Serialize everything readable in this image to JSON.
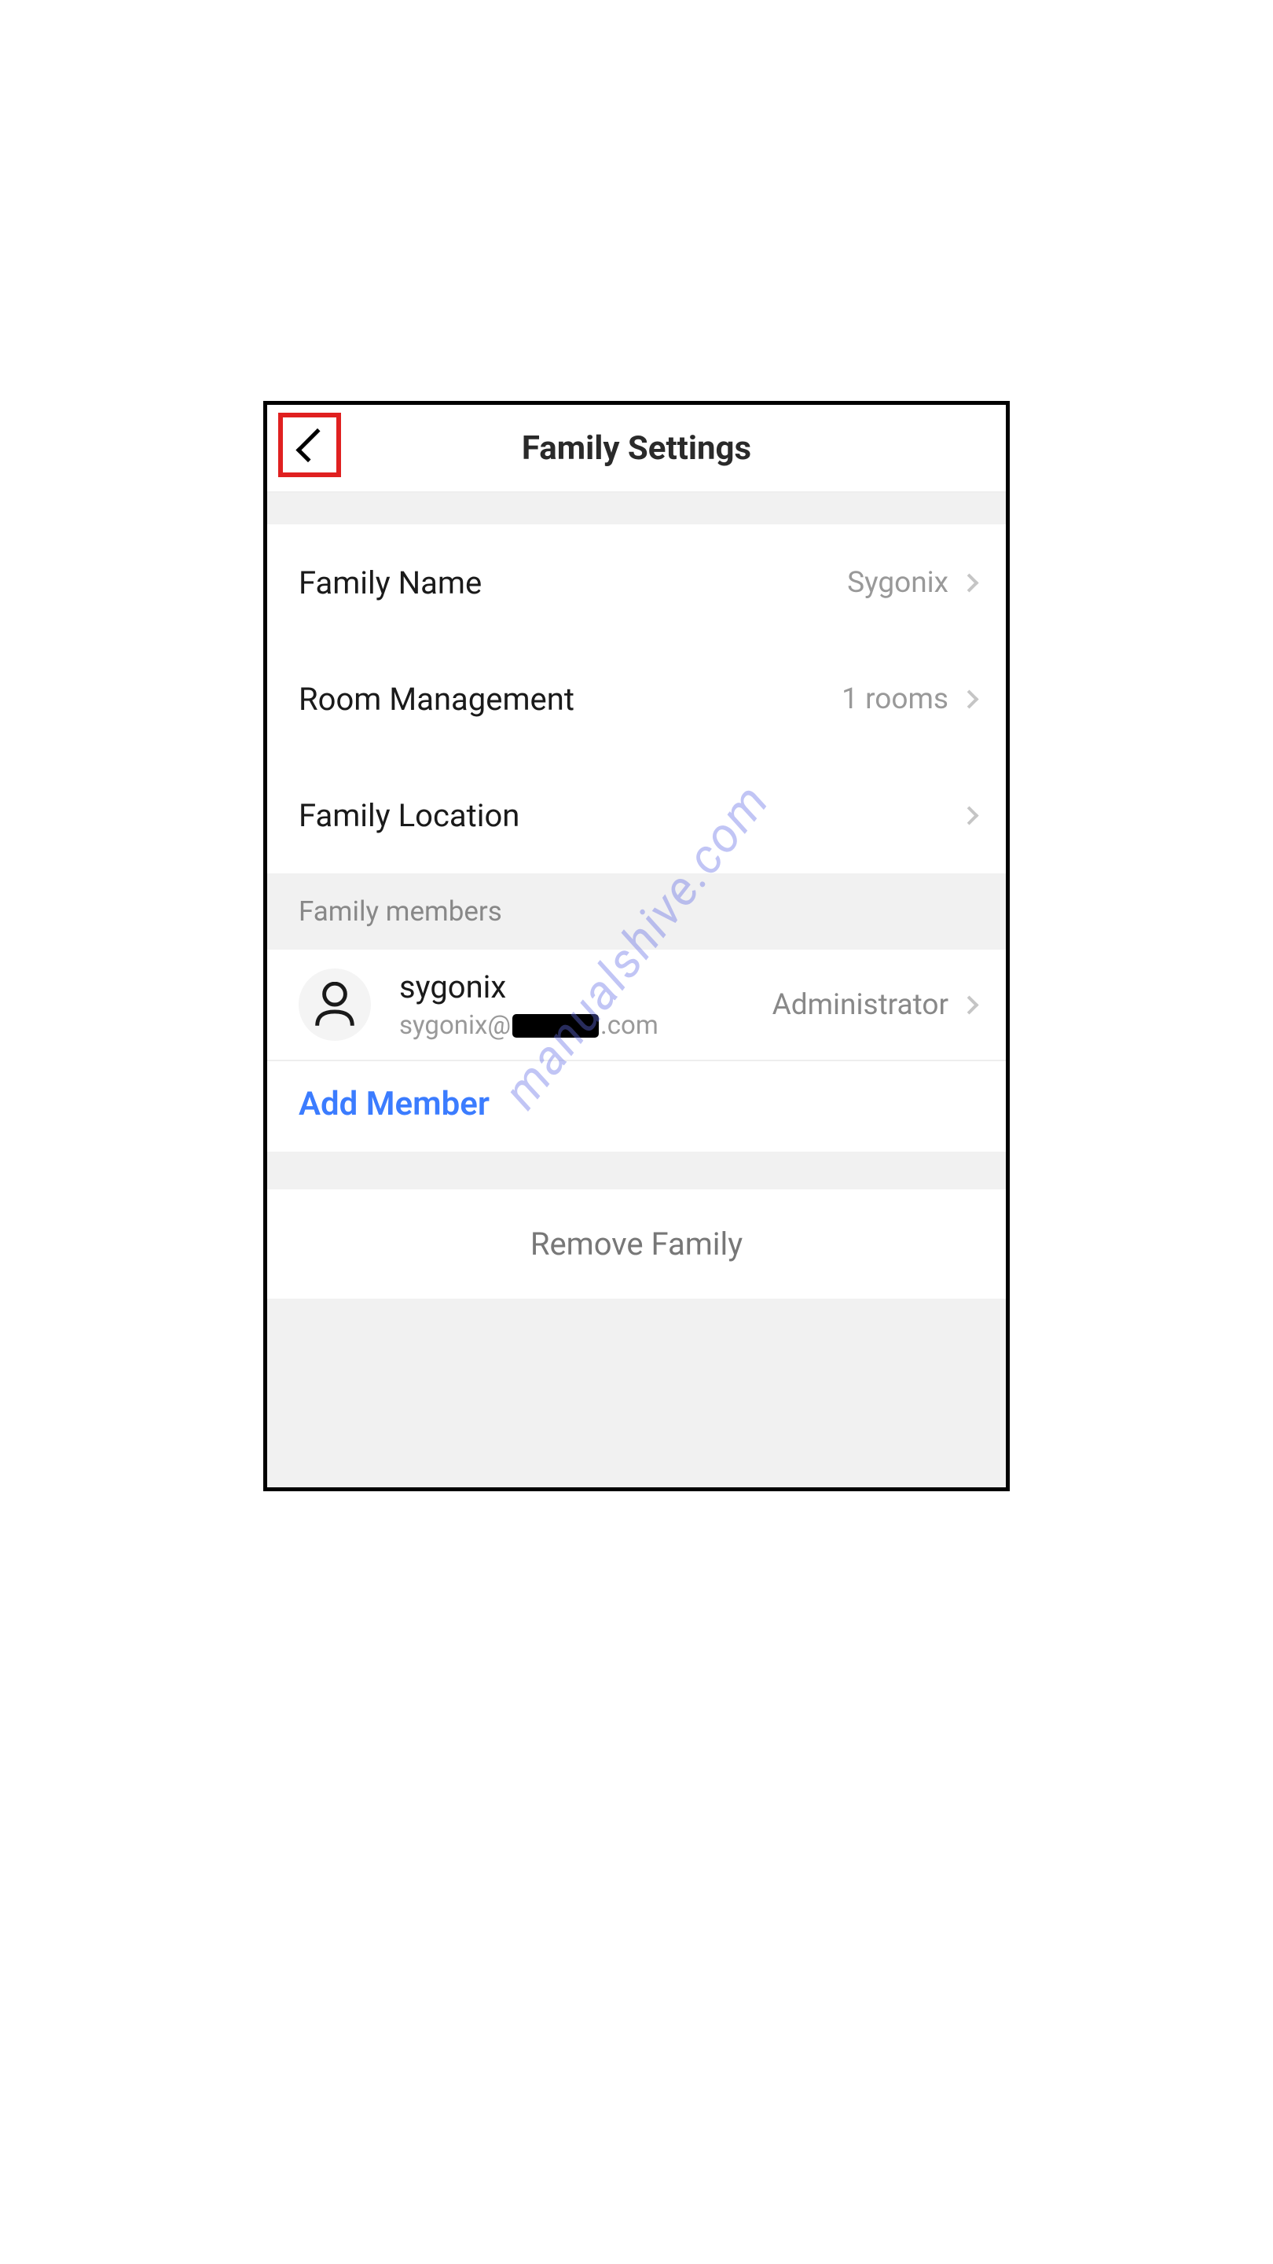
{
  "watermark": "manualshive.com",
  "header": {
    "title": "Family Settings"
  },
  "settings": {
    "family_name": {
      "label": "Family Name",
      "value": "Sygonix"
    },
    "room_management": {
      "label": "Room Management",
      "value": "1 rooms"
    },
    "family_location": {
      "label": "Family Location",
      "value": ""
    }
  },
  "members_section": {
    "header": "Family members",
    "members": [
      {
        "name": "sygonix",
        "email_prefix": "sygonix@",
        "email_suffix": ".com",
        "role": "Administrator"
      }
    ],
    "add_member_label": "Add Member"
  },
  "remove_family_label": "Remove Family"
}
